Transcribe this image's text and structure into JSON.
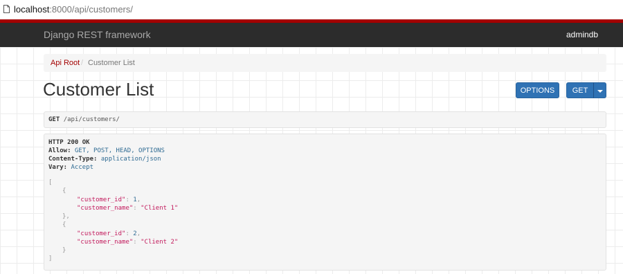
{
  "browser": {
    "url_host": "localhost",
    "url_rest": ":8000/api/customers/"
  },
  "navbar": {
    "brand": "Django REST framework",
    "user": "admindb"
  },
  "breadcrumb": {
    "root": "Api Root",
    "separator": "/",
    "current": "Customer List"
  },
  "page": {
    "title": "Customer List"
  },
  "buttons": {
    "options": "OPTIONS",
    "get": "GET"
  },
  "request": {
    "method": "GET",
    "path": "/api/customers/"
  },
  "response": {
    "status_line": "HTTP 200 OK",
    "headers": [
      {
        "name": "Allow:",
        "value": "GET, POST, HEAD, OPTIONS"
      },
      {
        "name": "Content-Type:",
        "value": "application/json"
      },
      {
        "name": "Vary:",
        "value": "Accept"
      }
    ],
    "body": {
      "open_bracket": "[",
      "close_bracket": "]",
      "open_brace": "{",
      "close_brace_comma": "},",
      "close_brace": "}",
      "id_key": "\"customer_id\"",
      "name_key": "\"customer_name\"",
      "colon": ": ",
      "comma": ",",
      "items": [
        {
          "customer_id": "1",
          "customer_name": "\"Client 1\""
        },
        {
          "customer_id": "2",
          "customer_name": "\"Client 2\""
        }
      ]
    }
  },
  "colors": {
    "navbar_bg": "#2c2c2c",
    "navbar_accent": "#a30000",
    "button_primary": "#2f72b4",
    "json_key": "#c2185b",
    "json_number": "#2f6b93"
  },
  "icons": {
    "page": "page-icon",
    "caret": "caret-down-icon"
  }
}
